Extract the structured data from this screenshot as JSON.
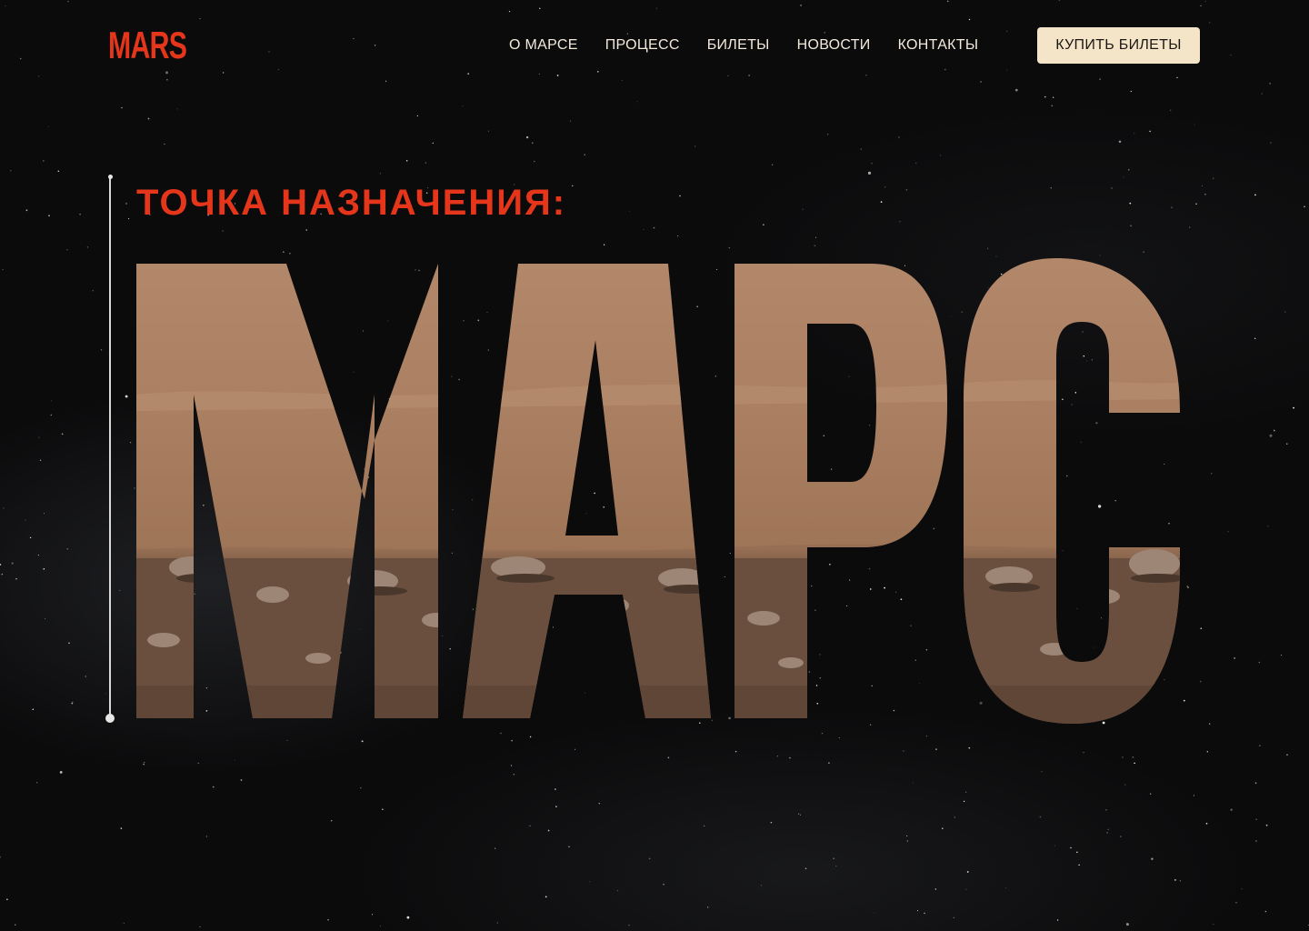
{
  "header": {
    "logo": "MARS",
    "nav": [
      {
        "label": "О МАРСЕ"
      },
      {
        "label": "ПРОЦЕСС"
      },
      {
        "label": "БИЛЕТЫ"
      },
      {
        "label": "НОВОСТИ"
      },
      {
        "label": "КОНТАКТЫ"
      }
    ],
    "buy_button": "КУПИТЬ БИЛЕТЫ"
  },
  "hero": {
    "subtitle": "ТОЧКА НАЗНАЧЕНИЯ:",
    "title": "МАРС"
  },
  "colors": {
    "accent": "#e5361b",
    "background": "#0b0b0c",
    "nav_text": "#f3eadb",
    "button_bg": "#f4e5c9",
    "mars_surface": "#a97c5e"
  },
  "icons": {
    "timeline": "vertical-line-with-dots"
  }
}
